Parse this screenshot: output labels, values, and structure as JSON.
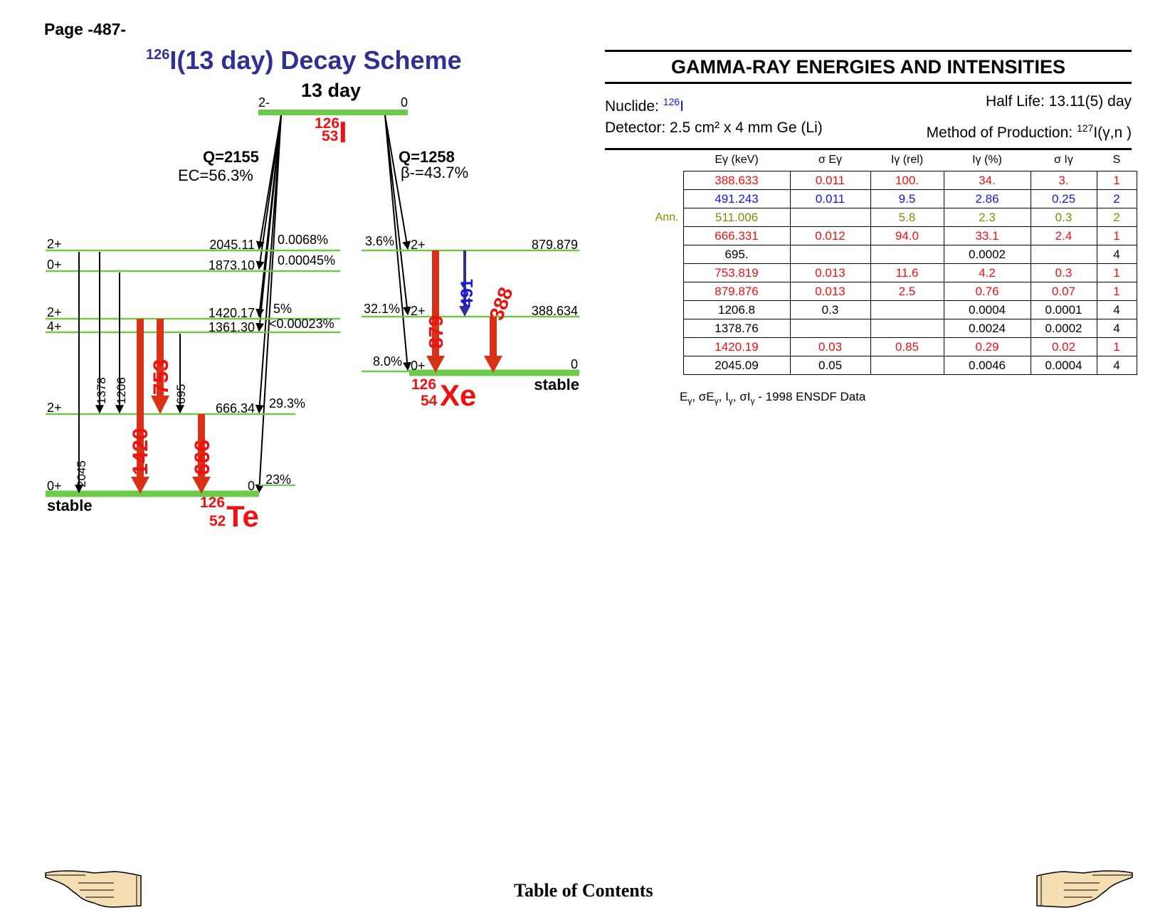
{
  "page_label": "Page -487-",
  "scheme": {
    "title_mass": "126",
    "title_text": "I(13 day) Decay Scheme",
    "parent": {
      "half_life": "13 day",
      "spin": "2-",
      "energy": "0",
      "mass": "126",
      "z": "53",
      "symbol": "I"
    },
    "ec_branch": {
      "q": "Q=2155",
      "pct": "EC=56.3%"
    },
    "beta_branch": {
      "q": "Q=1258",
      "pct": "β-=43.7%"
    },
    "te": {
      "mass": "126",
      "z": "52",
      "symbol": "Te",
      "stable": "stable",
      "levels": [
        {
          "spin": "2+",
          "energy": "2045.11",
          "feed": "0.0068%"
        },
        {
          "spin": "0+",
          "energy": "1873.10",
          "feed": "0.00045%"
        },
        {
          "spin": "2+",
          "energy": "1420.17",
          "feed": "5%"
        },
        {
          "spin": "4+",
          "energy": "1361.30",
          "feed": "<0.00023%"
        },
        {
          "spin": "2+",
          "energy": "666.34",
          "feed": "29.3%"
        },
        {
          "spin": "0+",
          "energy": "0",
          "feed": "23%"
        }
      ],
      "gammas": [
        "2045",
        "1378",
        "1206",
        "1420",
        "753",
        "695",
        "666"
      ]
    },
    "xe": {
      "mass": "126",
      "z": "54",
      "symbol": "Xe",
      "stable": "stable",
      "levels": [
        {
          "spin": "2+",
          "energy": "879.879",
          "feed": "3.6%"
        },
        {
          "spin": "2+",
          "energy": "388.634",
          "feed": "32.1%"
        },
        {
          "spin": "0+",
          "energy": "0",
          "feed": "8.0%"
        }
      ],
      "gammas": [
        "879",
        "491",
        "388"
      ]
    },
    "colors": {
      "level_line": "#6ec84a",
      "strong_gamma": "#d93018",
      "medium_gamma": "#ee1111",
      "xe_491": "#1414e6",
      "title": "#2e3192"
    }
  },
  "gamma_panel": {
    "heading": "GAMMA-RAY ENERGIES AND INTENSITIES",
    "nuclide_label": "Nuclide: ",
    "nuclide_mass": "126",
    "nuclide_symbol": "I",
    "half_life": "Half Life: 13.11(5) day",
    "detector": "Detector: 2.5 cm² x 4 mm Ge (Li)",
    "production_label": "Method of Production: ",
    "production_mass": "127",
    "production_reaction": "I(γ,n )",
    "columns": [
      "Eγ (keV)",
      "σ Eγ",
      "Iγ (rel)",
      "Iγ (%)",
      "σ Iγ",
      "S"
    ],
    "rows": [
      {
        "label": "",
        "color": "red",
        "cells": [
          "388.633",
          "0.011",
          "100.",
          "34.",
          "3.",
          "1"
        ]
      },
      {
        "label": "",
        "color": "blue",
        "cells": [
          "491.243",
          "0.011",
          "9.5",
          "2.86",
          "0.25",
          "2"
        ]
      },
      {
        "label": "Ann.",
        "color": "olive",
        "cells": [
          "511.006",
          "",
          "5.8",
          "2.3",
          "0.3",
          "2"
        ]
      },
      {
        "label": "",
        "color": "red",
        "cells": [
          "666.331",
          "0.012",
          "94.0",
          "33.1",
          "2.4",
          "1"
        ]
      },
      {
        "label": "",
        "color": "black",
        "cells": [
          "695.",
          "",
          "",
          "0.0002",
          "",
          "4"
        ]
      },
      {
        "label": "",
        "color": "red",
        "cells": [
          "753.819",
          "0.013",
          "11.6",
          "4.2",
          "0.3",
          "1"
        ]
      },
      {
        "label": "",
        "color": "red",
        "cells": [
          "879.876",
          "0.013",
          "2.5",
          "0.76",
          "0.07",
          "1"
        ]
      },
      {
        "label": "",
        "color": "black",
        "cells": [
          "1206.8",
          "0.3",
          "",
          "0.0004",
          "0.0001",
          "4"
        ]
      },
      {
        "label": "",
        "color": "black",
        "cells": [
          "1378.76",
          "",
          "",
          "0.0024",
          "0.0002",
          "4"
        ]
      },
      {
        "label": "",
        "color": "red",
        "cells": [
          "1420.19",
          "0.03",
          "0.85",
          "0.29",
          "0.02",
          "1"
        ]
      },
      {
        "label": "",
        "color": "black",
        "cells": [
          "2045.09",
          "0.05",
          "",
          "0.0046",
          "0.0004",
          "4"
        ]
      }
    ],
    "source_note": "- 1998 ENSDF Data"
  },
  "footer": {
    "toc": "Table of Contents",
    "prev_icon": "pointing-hand-left-icon",
    "next_icon": "pointing-hand-right-icon"
  }
}
